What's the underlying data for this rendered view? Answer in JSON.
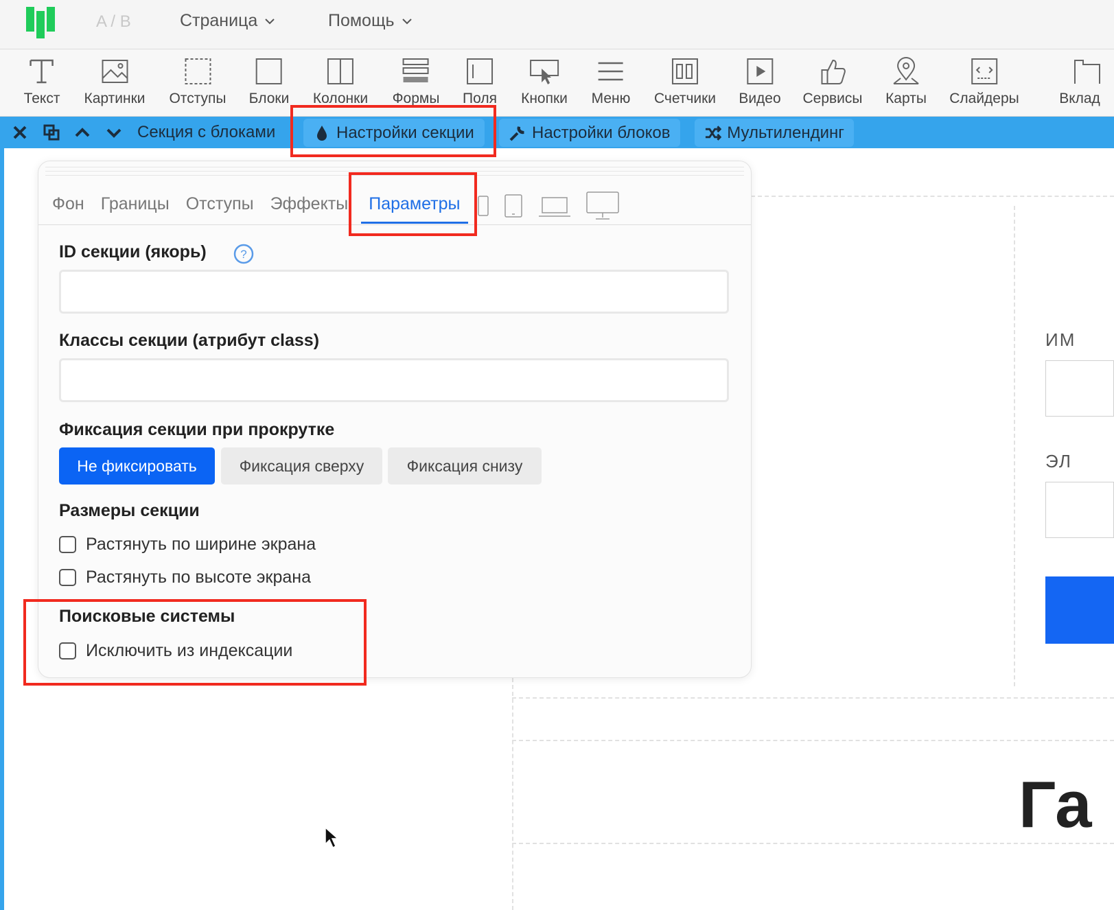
{
  "topbar": {
    "ab_label": "A / B",
    "menus": [
      "Страница",
      "Помощь"
    ]
  },
  "toolbar": {
    "items": [
      "Текст",
      "Картинки",
      "Отступы",
      "Блоки",
      "Колонки",
      "Формы",
      "Поля",
      "Кнопки",
      "Меню",
      "Счетчики",
      "Видео",
      "Сервисы",
      "Карты",
      "Слайдеры",
      "Вклад"
    ]
  },
  "section_bar": {
    "label": "Секция с блоками",
    "section_settings": "Настройки секции",
    "block_settings": "Настройки блоков",
    "multilanding": "Мультилендинг"
  },
  "panel": {
    "tabs": [
      "Фон",
      "Границы",
      "Отступы",
      "Эффекты",
      "Параметры"
    ],
    "active_tab": "Параметры",
    "section_id_label": "ID секции (якорь)",
    "section_id_value": "",
    "section_classes_label": "Классы секции (атрибут class)",
    "section_classes_value": "",
    "fixation_label": "Фиксация секции при прокрутке",
    "fixation_options": [
      "Не фиксировать",
      "Фиксация сверху",
      "Фиксация снизу"
    ],
    "fixation_selected": "Не фиксировать",
    "sizes_label": "Размеры секции",
    "stretch_width": "Растянуть по ширине экрана",
    "stretch_height": "Растянуть по высоте экрана",
    "search_label": "Поисковые системы",
    "exclude_indexing": "Исключить из индексации"
  },
  "background": {
    "label_name": "ИМ",
    "label_email": "ЭЛ",
    "heading": "Га"
  },
  "colors": {
    "accent": "#35a4ec",
    "primary_button": "#0b64f4",
    "highlight": "#f12a1f",
    "logo": "#1fcc5a"
  }
}
